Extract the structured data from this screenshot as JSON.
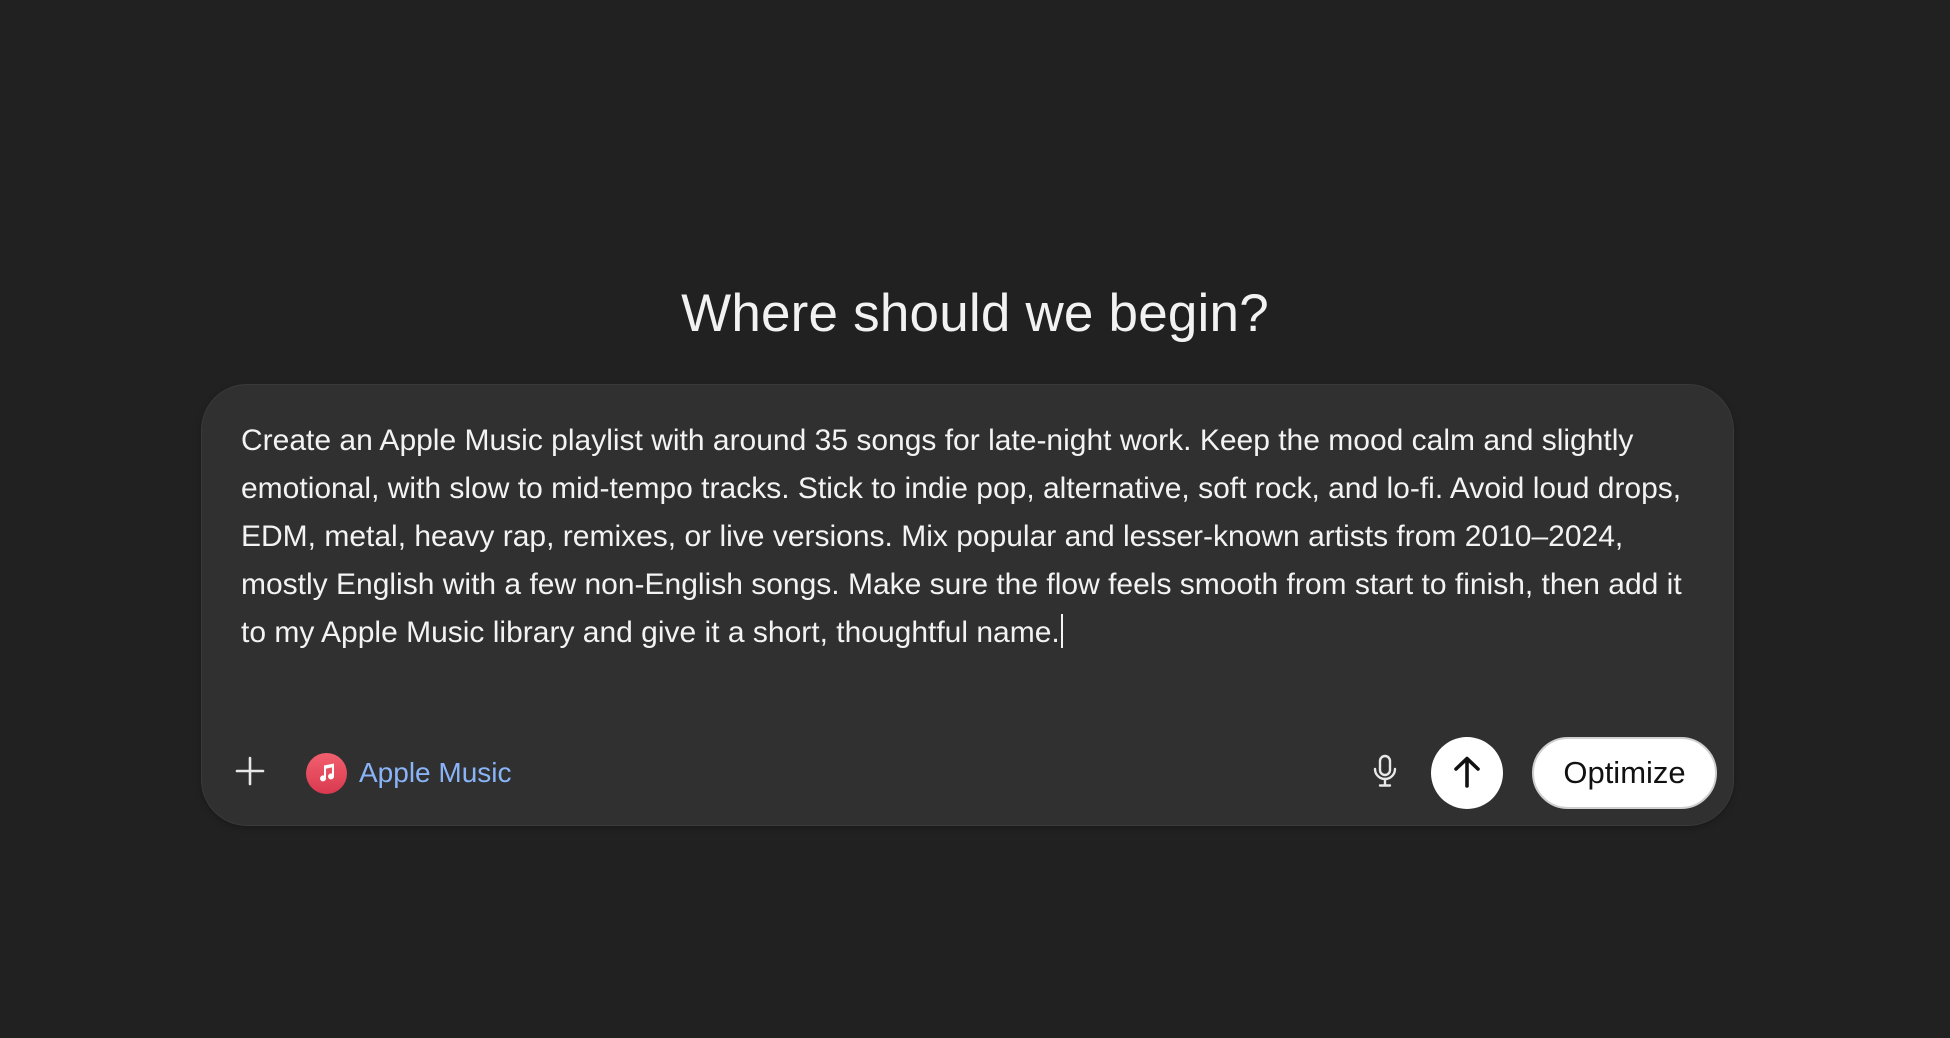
{
  "main": {
    "heading": "Where should we begin?"
  },
  "composer": {
    "prompt_text": "Create an Apple Music playlist with around 35 songs for late-night work. Keep the mood calm and slightly emotional, with slow to mid-tempo tracks. Stick to indie pop, alternative, soft rock, and lo-fi. Avoid loud drops, EDM, metal, heavy rap, remixes, or live versions. Mix popular and lesser-known artists from 2010–2024, mostly English with a few non-English songs. Make sure the flow feels smooth from start to finish, then add it to my Apple Music library and give it a short, thoughtful name.",
    "connector": {
      "label": "Apple Music",
      "icon": "music-note-icon",
      "color": "#8ab4f8",
      "badge_color": "#e2475a"
    },
    "buttons": {
      "optimize_label": "Optimize"
    },
    "icons": {
      "add": "plus-icon",
      "mic": "microphone-icon",
      "send": "arrow-up-icon"
    }
  },
  "theme": {
    "background": "#212121",
    "composer_background": "#303030",
    "text": "#f3f3f3"
  }
}
